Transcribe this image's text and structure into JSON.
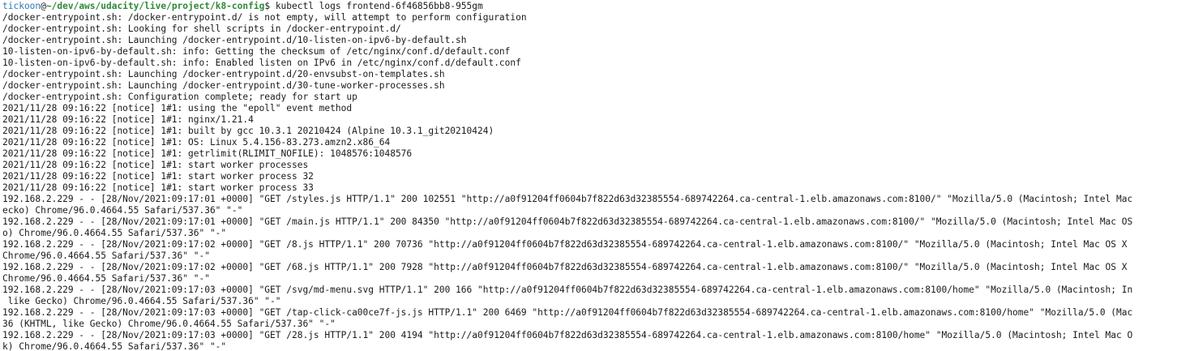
{
  "prompt": {
    "user": "tickoon",
    "at": "@",
    "cwd": "~/dev/aws/udacity/live/project/k8-config",
    "symbol": "$ ",
    "command": "kubectl logs frontend-6f46856bb8-955gm"
  },
  "output_lines": [
    "/docker-entrypoint.sh: /docker-entrypoint.d/ is not empty, will attempt to perform configuration",
    "/docker-entrypoint.sh: Looking for shell scripts in /docker-entrypoint.d/",
    "/docker-entrypoint.sh: Launching /docker-entrypoint.d/10-listen-on-ipv6-by-default.sh",
    "10-listen-on-ipv6-by-default.sh: info: Getting the checksum of /etc/nginx/conf.d/default.conf",
    "10-listen-on-ipv6-by-default.sh: info: Enabled listen on IPv6 in /etc/nginx/conf.d/default.conf",
    "/docker-entrypoint.sh: Launching /docker-entrypoint.d/20-envsubst-on-templates.sh",
    "/docker-entrypoint.sh: Launching /docker-entrypoint.d/30-tune-worker-processes.sh",
    "/docker-entrypoint.sh: Configuration complete; ready for start up",
    "2021/11/28 09:16:22 [notice] 1#1: using the \"epoll\" event method",
    "2021/11/28 09:16:22 [notice] 1#1: nginx/1.21.4",
    "2021/11/28 09:16:22 [notice] 1#1: built by gcc 10.3.1 20210424 (Alpine 10.3.1_git20210424)",
    "2021/11/28 09:16:22 [notice] 1#1: OS: Linux 5.4.156-83.273.amzn2.x86_64",
    "2021/11/28 09:16:22 [notice] 1#1: getrlimit(RLIMIT_NOFILE): 1048576:1048576",
    "2021/11/28 09:16:22 [notice] 1#1: start worker processes",
    "2021/11/28 09:16:22 [notice] 1#1: start worker process 32",
    "2021/11/28 09:16:22 [notice] 1#1: start worker process 33",
    "192.168.2.229 - - [28/Nov/2021:09:17:01 +0000] \"GET /styles.js HTTP/1.1\" 200 102551 \"http://a0f91204ff0604b7f822d63d32385554-689742264.ca-central-1.elb.amazonaws.com:8100/\" \"Mozilla/5.0 (Macintosh; Intel Mac",
    "ecko) Chrome/96.0.4664.55 Safari/537.36\" \"-\"",
    "192.168.2.229 - - [28/Nov/2021:09:17:01 +0000] \"GET /main.js HTTP/1.1\" 200 84350 \"http://a0f91204ff0604b7f822d63d32385554-689742264.ca-central-1.elb.amazonaws.com:8100/\" \"Mozilla/5.0 (Macintosh; Intel Mac OS",
    "o) Chrome/96.0.4664.55 Safari/537.36\" \"-\"",
    "192.168.2.229 - - [28/Nov/2021:09:17:02 +0000] \"GET /8.js HTTP/1.1\" 200 70736 \"http://a0f91204ff0604b7f822d63d32385554-689742264.ca-central-1.elb.amazonaws.com:8100/\" \"Mozilla/5.0 (Macintosh; Intel Mac OS X",
    "Chrome/96.0.4664.55 Safari/537.36\" \"-\"",
    "192.168.2.229 - - [28/Nov/2021:09:17:02 +0000] \"GET /68.js HTTP/1.1\" 200 7928 \"http://a0f91204ff0604b7f822d63d32385554-689742264.ca-central-1.elb.amazonaws.com:8100/\" \"Mozilla/5.0 (Macintosh; Intel Mac OS X",
    "Chrome/96.0.4664.55 Safari/537.36\" \"-\"",
    "192.168.2.229 - - [28/Nov/2021:09:17:03 +0000] \"GET /svg/md-menu.svg HTTP/1.1\" 200 166 \"http://a0f91204ff0604b7f822d63d32385554-689742264.ca-central-1.elb.amazonaws.com:8100/home\" \"Mozilla/5.0 (Macintosh; In",
    " like Gecko) Chrome/96.0.4664.55 Safari/537.36\" \"-\"",
    "192.168.2.229 - - [28/Nov/2021:09:17:03 +0000] \"GET /tap-click-ca00ce7f-js.js HTTP/1.1\" 200 6469 \"http://a0f91204ff0604b7f822d63d32385554-689742264.ca-central-1.elb.amazonaws.com:8100/home\" \"Mozilla/5.0 (Mac",
    "36 (KHTML, like Gecko) Chrome/96.0.4664.55 Safari/537.36\" \"-\"",
    "192.168.2.229 - - [28/Nov/2021:09:17:03 +0000] \"GET /28.js HTTP/1.1\" 200 4194 \"http://a0f91204ff0604b7f822d63d32385554-689742264.ca-central-1.elb.amazonaws.com:8100/home\" \"Mozilla/5.0 (Macintosh; Intel Mac O",
    "k) Chrome/96.0.4664.55 Safari/537.36\" \"-\""
  ],
  "colors": {
    "background": "#ffffff",
    "text": "#1a1a1a",
    "user": "#2a7bb5",
    "path": "#2f8a3a"
  }
}
